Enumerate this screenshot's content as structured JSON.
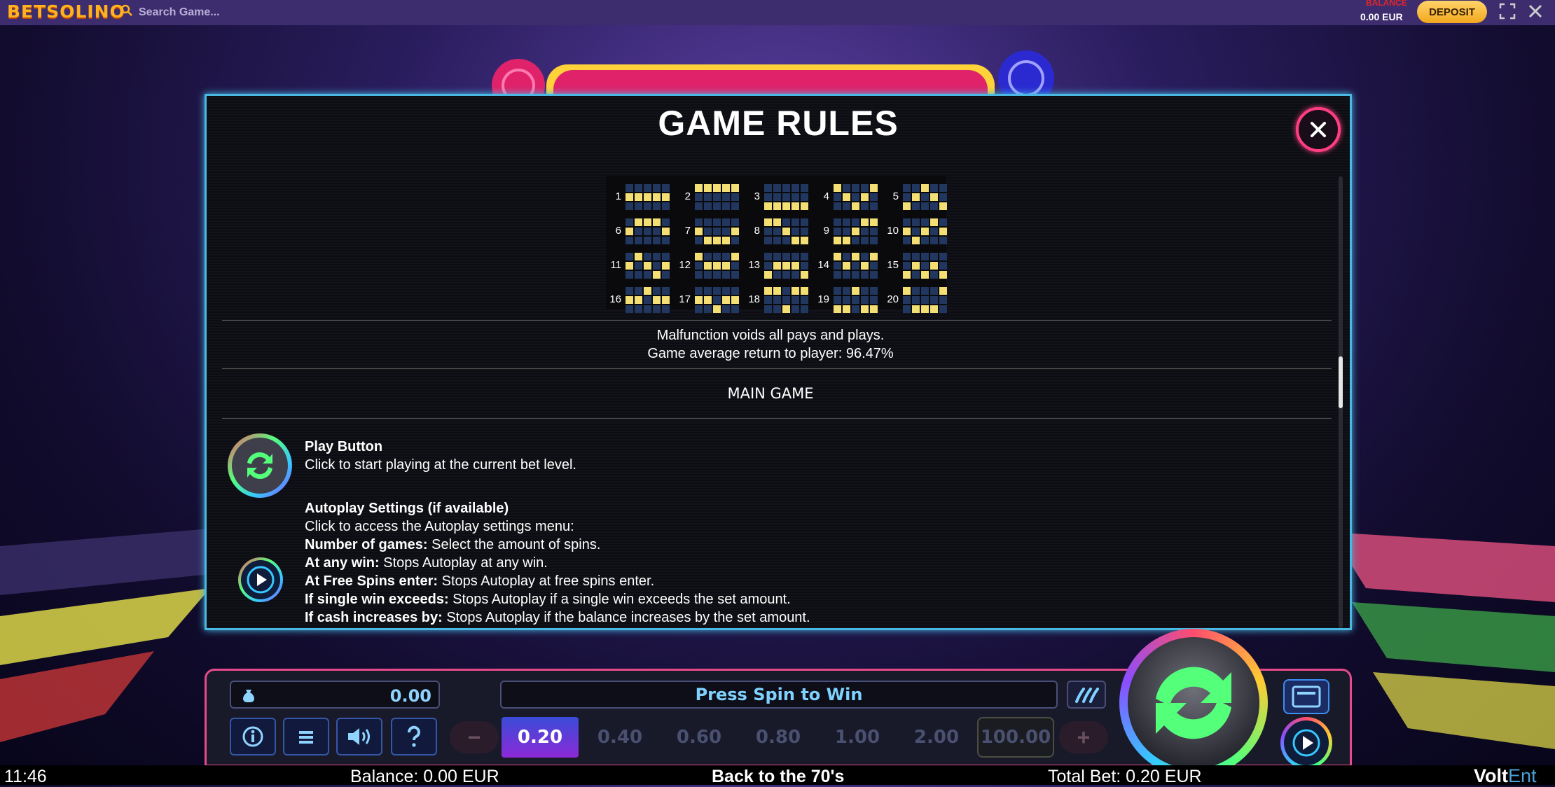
{
  "topbar": {
    "logo": "BETSOLINO",
    "search_placeholder": "Search Game...",
    "balance_label": "BALANCE",
    "balance_value": "0.00 EUR",
    "deposit_label": "DEPOSIT"
  },
  "modal": {
    "title": "GAME RULES",
    "paylines": [
      {
        "n": "1",
        "rows": [
          1,
          1,
          1,
          1,
          1
        ]
      },
      {
        "n": "2",
        "rows": [
          0,
          0,
          0,
          0,
          0
        ]
      },
      {
        "n": "3",
        "rows": [
          2,
          2,
          2,
          2,
          2
        ]
      },
      {
        "n": "4",
        "rows": [
          0,
          1,
          2,
          1,
          0
        ]
      },
      {
        "n": "5",
        "rows": [
          2,
          1,
          0,
          1,
          2
        ]
      },
      {
        "n": "6",
        "rows": [
          1,
          0,
          0,
          0,
          1
        ]
      },
      {
        "n": "7",
        "rows": [
          1,
          2,
          2,
          2,
          1
        ]
      },
      {
        "n": "8",
        "rows": [
          0,
          0,
          1,
          2,
          2
        ]
      },
      {
        "n": "9",
        "rows": [
          2,
          2,
          1,
          0,
          0
        ]
      },
      {
        "n": "10",
        "rows": [
          1,
          2,
          1,
          0,
          1
        ]
      },
      {
        "n": "11",
        "rows": [
          1,
          0,
          1,
          2,
          1
        ]
      },
      {
        "n": "12",
        "rows": [
          0,
          1,
          1,
          1,
          0
        ]
      },
      {
        "n": "13",
        "rows": [
          2,
          1,
          1,
          1,
          2
        ]
      },
      {
        "n": "14",
        "rows": [
          0,
          1,
          0,
          1,
          0
        ]
      },
      {
        "n": "15",
        "rows": [
          2,
          1,
          2,
          1,
          2
        ]
      },
      {
        "n": "16",
        "rows": [
          1,
          1,
          0,
          1,
          1
        ]
      },
      {
        "n": "17",
        "rows": [
          1,
          1,
          2,
          1,
          1
        ]
      },
      {
        "n": "18",
        "rows": [
          0,
          0,
          2,
          0,
          0
        ]
      },
      {
        "n": "19",
        "rows": [
          2,
          2,
          0,
          2,
          2
        ]
      },
      {
        "n": "20",
        "rows": [
          0,
          2,
          2,
          2,
          0
        ]
      }
    ],
    "malfunction": "Malfunction voids all pays and plays.",
    "rtp": "Game average return to player: 96.47%",
    "section": "MAIN GAME",
    "play_title": "Play Button",
    "play_desc": "Click to start playing at the current bet level.",
    "auto_title": "Autoplay Settings (if available)",
    "auto_intro": "Click to access the Autoplay settings menu:",
    "auto_items": [
      {
        "label": "Number of games:",
        "text": " Select the amount of spins."
      },
      {
        "label": "At any win:",
        "text": " Stops Autoplay at any win."
      },
      {
        "label": "At Free Spins enter:",
        "text": " Stops Autoplay at free spins enter."
      },
      {
        "label": "If single win exceeds:",
        "text": " Stops Autoplay if a single win exceeds the set amount."
      },
      {
        "label": "If cash increases by:",
        "text": " Stops Autoplay if the balance increases by the set amount."
      }
    ],
    "scroll_position": 0.45
  },
  "panel": {
    "win_value": "0.00",
    "message": "Press Spin to Win",
    "bets": [
      "0.20",
      "0.40",
      "0.60",
      "0.80",
      "1.00",
      "2.00",
      "100.00"
    ],
    "selected_bet": "0.20",
    "minus": "−",
    "plus": "+"
  },
  "infobar": {
    "time": "11:46",
    "balance": "Balance: 0.00 EUR",
    "game": "Back to the 70's",
    "total_bet": "Total Bet: 0.20 EUR",
    "brand_a": "Volt",
    "brand_b": "Ent"
  },
  "colors": {
    "modal_border": "#49b9e3",
    "close_ring": "#ff3e82",
    "payline_on": "#f3df73",
    "payline_off": "#22375f",
    "message_text": "#7fd2ff",
    "deposit": "#f2a81d"
  }
}
